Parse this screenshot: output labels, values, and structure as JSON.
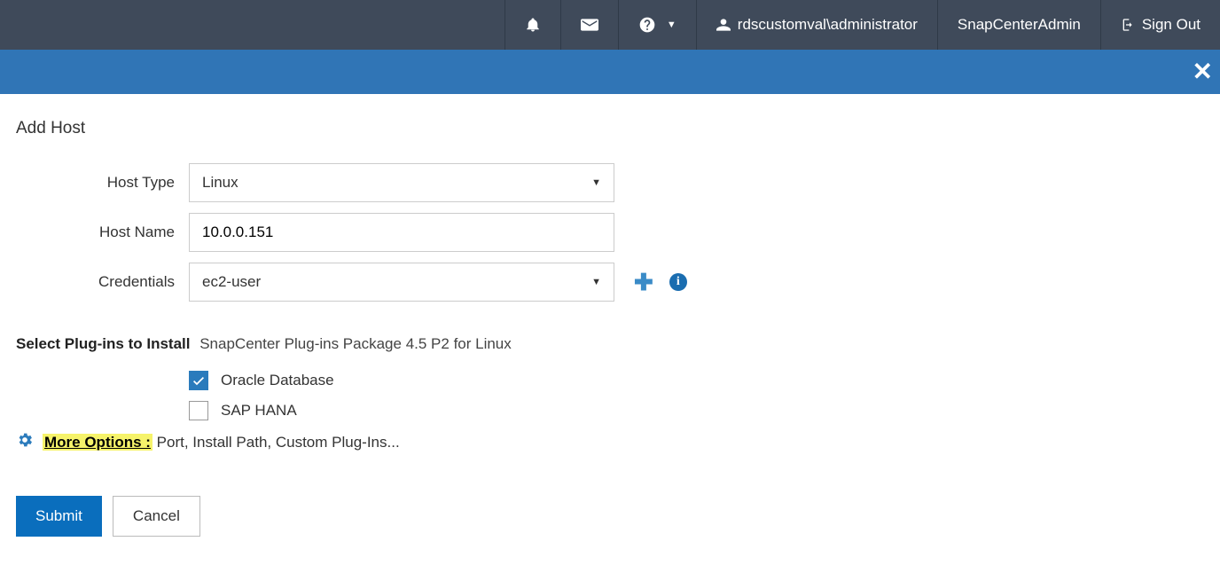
{
  "header": {
    "user": "rdscustomval\\administrator",
    "role": "SnapCenterAdmin",
    "signout": "Sign Out"
  },
  "page": {
    "title": "Add Host"
  },
  "form": {
    "hostTypeLabel": "Host Type",
    "hostTypeValue": "Linux",
    "hostNameLabel": "Host Name",
    "hostNameValue": "10.0.0.151",
    "credentialsLabel": "Credentials",
    "credentialsValue": "ec2-user"
  },
  "plugins": {
    "headerStrong": "Select Plug-ins to Install",
    "headerPkg": "SnapCenter Plug-ins Package 4.5 P2 for Linux",
    "items": [
      {
        "label": "Oracle Database",
        "checked": true
      },
      {
        "label": "SAP HANA",
        "checked": false
      }
    ]
  },
  "moreOptions": {
    "link": "More Options :",
    "rest": " Port, Install Path, Custom Plug-Ins..."
  },
  "buttons": {
    "submit": "Submit",
    "cancel": "Cancel"
  }
}
